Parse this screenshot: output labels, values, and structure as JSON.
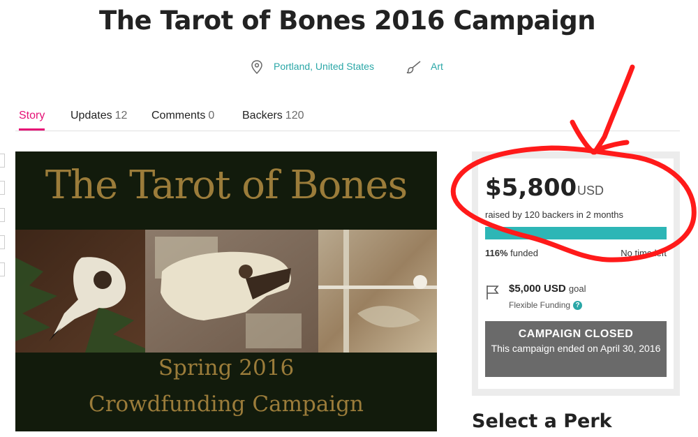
{
  "campaign": {
    "title": "The Tarot of Bones 2016 Campaign",
    "location": "Portland, United States",
    "category": "Art",
    "location_icon": "map-pin-icon",
    "category_icon": "paintbrush-icon"
  },
  "tabs": [
    {
      "label": "Story",
      "count": "",
      "active": true
    },
    {
      "label": "Updates",
      "count": "12",
      "active": false
    },
    {
      "label": "Comments",
      "count": "0",
      "active": false
    },
    {
      "label": "Backers",
      "count": "120",
      "active": false
    }
  ],
  "hero": {
    "title": "The Tarot of Bones",
    "subtitle_line1": "Spring 2016",
    "subtitle_line2": "Crowdfunding Campaign"
  },
  "funding": {
    "amount": "$5,800",
    "currency": "USD",
    "raised_text": "raised by 120 backers in 2 months",
    "progress_fraction": 1.0,
    "funded_percent": "116%",
    "funded_suffix": "funded",
    "time_left": "No time left",
    "goal_amount": "$5,000 USD",
    "goal_label": "goal",
    "flexible": "Flexible Funding",
    "help_glyph": "?"
  },
  "status": {
    "title": "CAMPAIGN CLOSED",
    "text": "This campaign ended on April 30, 2016"
  },
  "perks": {
    "heading": "Select a Perk"
  },
  "colors": {
    "accent_teal": "#2db6b6",
    "active_tab": "#e51075",
    "annotation_red": "#ff1a1a",
    "closed_bg": "#6a6a6a"
  }
}
